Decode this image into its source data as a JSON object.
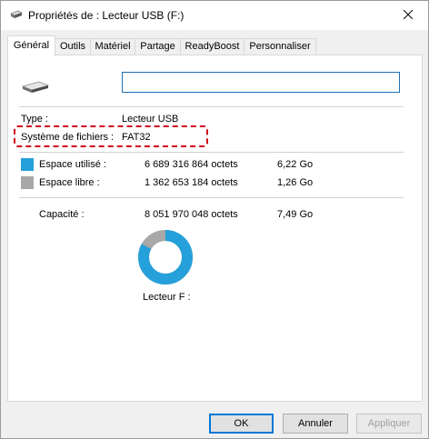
{
  "window": {
    "title": "Propriétés de : Lecteur USB (F:)",
    "close_glyph": "✕"
  },
  "tabs": [
    {
      "label": "Général",
      "active": true
    },
    {
      "label": "Outils"
    },
    {
      "label": "Matériel"
    },
    {
      "label": "Partage"
    },
    {
      "label": "ReadyBoost"
    },
    {
      "label": "Personnaliser"
    }
  ],
  "general": {
    "name_value": "",
    "type_label": "Type :",
    "type_value": "Lecteur USB",
    "fs_label": "Système de fichiers :",
    "fs_value": "FAT32",
    "used_label": "Espace utilisé :",
    "used_bytes": "6 689 316 864 octets",
    "used_size": "6,22 Go",
    "free_label": "Espace libre :",
    "free_bytes": "1 362 653 184 octets",
    "free_size": "1,26 Go",
    "capacity_label": "Capacité :",
    "capacity_bytes": "8 051 970 048 octets",
    "capacity_size": "7,49 Go",
    "drive_label": "Lecteur F :",
    "used_fraction": 0.8308
  },
  "colors": {
    "used": "#26a0da",
    "free": "#a8a8a8",
    "highlight": "#d0021b"
  },
  "buttons": {
    "ok": "OK",
    "cancel": "Annuler",
    "apply": "Appliquer"
  }
}
